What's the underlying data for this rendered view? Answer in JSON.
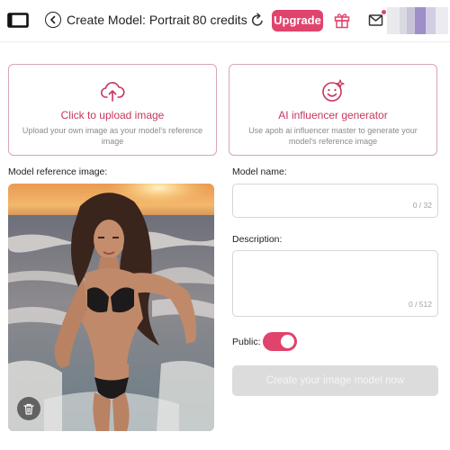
{
  "header": {
    "logo_icon": "window-frame-icon",
    "back_icon": "chevron-left-icon",
    "title": "Create Model: Portrait",
    "credits": "80 credits",
    "refresh_icon": "refresh-icon",
    "upgrade_label": "Upgrade",
    "gift_icon": "gift-icon",
    "mail_icon": "mail-icon",
    "avatar_icon": "user-avatar"
  },
  "upload_card": {
    "icon": "cloud-upload-icon",
    "title": "Click to upload image",
    "description": "Upload your own image as your model's reference image"
  },
  "ai_card": {
    "icon": "smiley-face-sparkle-icon",
    "title": "AI influencer generator",
    "description": "Use apob ai influencer master to generate your model's reference image"
  },
  "reference_image": {
    "label": "Model reference image:",
    "image_description": "woman in black bikini on beach at sunset",
    "delete_icon": "trash-icon"
  },
  "model_name": {
    "label": "Model name:",
    "value": "",
    "counter": "0 / 32"
  },
  "description": {
    "label": "Description:",
    "value": "",
    "counter": "0 / 512"
  },
  "public": {
    "label": "Public:",
    "enabled": true
  },
  "submit": {
    "label": "Create your image model now",
    "disabled": true
  },
  "colors": {
    "accent": "#e0436c",
    "accent_text": "#c7365e",
    "card_border": "#d9a5b3",
    "disabled_button": "#dcdcdc"
  }
}
